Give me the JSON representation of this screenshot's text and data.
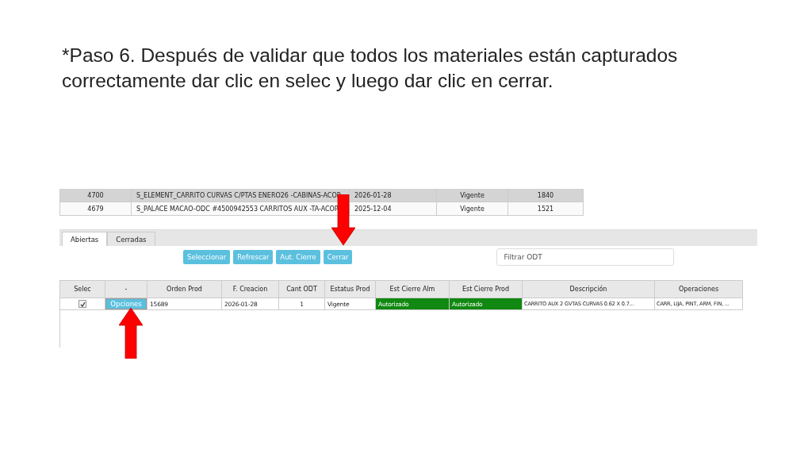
{
  "instruction": "*Paso 6. Después de validar que todos los materiales están capturados correctamente dar clic en selec y luego dar clic en cerrar.",
  "top_table": {
    "rows": [
      {
        "cells": [
          "4700",
          "S_ELEMENT_CARRITO CURVAS C/PTAS ENERO26 -CABINAS-ACOP",
          "2026-01-28",
          "Vigente",
          "1840"
        ],
        "selected": true
      },
      {
        "cells": [
          "4679",
          "S_PALACE MACAO-ODC #4500942553 CARRITOS AUX -TA-ACOP",
          "2025-12-04",
          "Vigente",
          "1521"
        ],
        "selected": false
      }
    ]
  },
  "tabs": [
    {
      "label": "Abiertas",
      "selected": true
    },
    {
      "label": "Cerradas",
      "selected": false
    }
  ],
  "buttons": [
    "Seleccionar",
    "Refrescar",
    "Aut. Cierre",
    "Cerrar"
  ],
  "filter": {
    "placeholder": "Filtrar ODT"
  },
  "table": {
    "columns": [
      "Selec",
      "-",
      "Orden Prod",
      "F. Creacion",
      "Cant ODT",
      "Estatus Prod",
      "Est Cierre Alm",
      "Est Cierre Prod",
      "Descripción",
      "Operaciones"
    ],
    "rows": [
      {
        "cells": [
          {
            "kind": "checkbox",
            "checked": true
          },
          {
            "kind": "button",
            "text": "Opciones"
          },
          {
            "text": "15689",
            "kind": "plain"
          },
          {
            "text": "2026-01-28",
            "kind": "plain"
          },
          {
            "text": "1",
            "kind": "number"
          },
          {
            "text": "Vigente",
            "kind": "plain"
          },
          {
            "text": "Autorizado",
            "kind": "status"
          },
          {
            "text": "Autorizado",
            "kind": "status"
          },
          {
            "text": "CARRITO AUX 2 GVTAS CURVAS 0.62 X 0.7...",
            "kind": "plain"
          },
          {
            "text": "CARR, LIJA, PINT, ARM, FIN, ...",
            "kind": "plain"
          }
        ]
      }
    ]
  }
}
